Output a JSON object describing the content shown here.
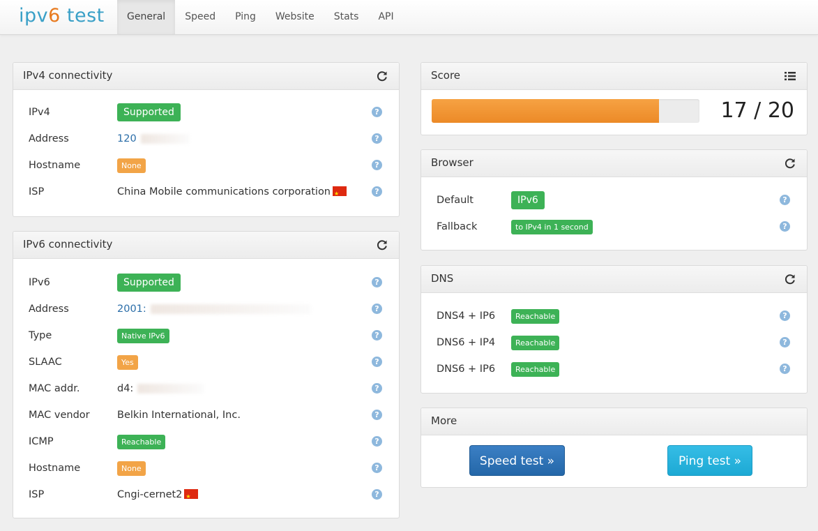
{
  "header": {
    "logo_prefix": "ipv",
    "logo_six": "6",
    "logo_suffix": " test",
    "tabs": [
      "General",
      "Speed",
      "Ping",
      "Website",
      "Stats",
      "API"
    ],
    "active_tab": "General"
  },
  "ipv4": {
    "title": "IPv4 connectivity",
    "rows": [
      {
        "key": "IPv4",
        "value": "Supported",
        "style": "badge-lg green"
      },
      {
        "key": "Address",
        "value": "120",
        "style": "link"
      },
      {
        "key": "Hostname",
        "value": "None",
        "style": "badge-sm orange"
      },
      {
        "key": "ISP",
        "value": "China Mobile communications corporation",
        "style": "text"
      }
    ]
  },
  "ipv6": {
    "title": "IPv6 connectivity",
    "rows": [
      {
        "key": "IPv6",
        "value": "Supported",
        "style": "badge-lg green"
      },
      {
        "key": "Address",
        "value": "2001:",
        "style": "link"
      },
      {
        "key": "Type",
        "value": "Native IPv6",
        "style": "badge-sm green"
      },
      {
        "key": "SLAAC",
        "value": "Yes",
        "style": "badge-sm orange"
      },
      {
        "key": "MAC addr.",
        "value": "d4:",
        "style": "text"
      },
      {
        "key": "MAC vendor",
        "value": "Belkin International, Inc.",
        "style": "text"
      },
      {
        "key": "ICMP",
        "value": "Reachable",
        "style": "badge-sm green"
      },
      {
        "key": "Hostname",
        "value": "None",
        "style": "badge-sm orange"
      },
      {
        "key": "ISP",
        "value": "Cngi-cernet2",
        "style": "text"
      }
    ]
  },
  "score": {
    "title": "Score",
    "value": 17,
    "max": 20,
    "text": "17 / 20",
    "bar_color": "#f0952f"
  },
  "browser": {
    "title": "Browser",
    "rows": [
      {
        "key": "Default",
        "value": "IPv6",
        "style": "badge-lg green"
      },
      {
        "key": "Fallback",
        "value": "to IPv4 in 1 second",
        "style": "badge-sm green"
      }
    ]
  },
  "dns": {
    "title": "DNS",
    "rows": [
      {
        "key": "DNS4 + IP6",
        "value": "Reachable",
        "style": "badge-sm green"
      },
      {
        "key": "DNS6 + IP4",
        "value": "Reachable",
        "style": "badge-sm green"
      },
      {
        "key": "DNS6 + IP6",
        "value": "Reachable",
        "style": "badge-sm green"
      }
    ]
  },
  "more": {
    "title": "More",
    "speed_button": "Speed test »",
    "ping_button": "Ping test »"
  },
  "icons": {
    "refresh": "refresh-icon",
    "list": "list-icon",
    "help": "question-mark-icon",
    "flag": "china-flag-icon"
  },
  "help_glyph": "?",
  "colors": {
    "green": "#3db256",
    "orange": "#f2a447",
    "link": "#2a6da8",
    "help": "#8eb8dd"
  }
}
